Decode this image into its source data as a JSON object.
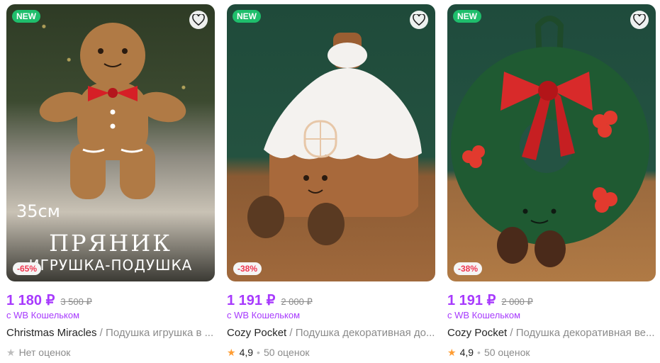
{
  "colors": {
    "price": "#a73afd",
    "new_badge": "#1fbe6c",
    "discount": "#f0364f",
    "star": "#ff9d33"
  },
  "products": [
    {
      "badge": "NEW",
      "discount": "-65%",
      "image_overlay": {
        "size": "35см",
        "title": "ПРЯНИК",
        "subtitle": "ИГРУШКА-ПОДУШКА"
      },
      "price": "1 180 ₽",
      "old_price": "3 500 ₽",
      "wallet": "с WB Кошельком",
      "brand": "Christmas Miracles",
      "separator": " / ",
      "name": "Подушка игрушка в ...",
      "rating_text": "Нет оценок"
    },
    {
      "badge": "NEW",
      "discount": "-38%",
      "price": "1 191 ₽",
      "old_price": "2 000 ₽",
      "wallet": "с WB Кошельком",
      "brand": "Cozy Pocket",
      "separator": " / ",
      "name": "Подушка декоративная до...",
      "rating": "4,9",
      "reviews": "50 оценок"
    },
    {
      "badge": "NEW",
      "discount": "-38%",
      "price": "1 191 ₽",
      "old_price": "2 000 ₽",
      "wallet": "с WB Кошельком",
      "brand": "Cozy Pocket",
      "separator": " / ",
      "name": "Подушка декоративная ве...",
      "rating": "4,9",
      "reviews": "50 оценок"
    }
  ]
}
